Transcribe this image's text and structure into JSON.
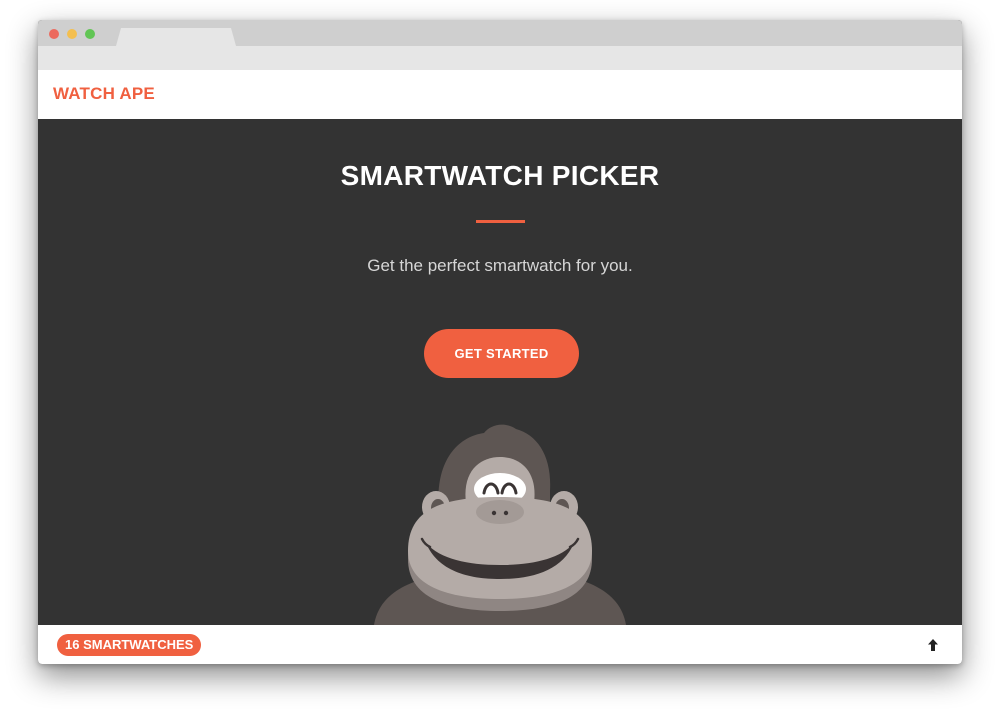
{
  "brand": {
    "name": "WATCH APE",
    "accent_color": "#f06040",
    "hero_background": "#333333"
  },
  "hero": {
    "title": "SMARTWATCH PICKER",
    "subtitle": "Get the perfect smartwatch for you.",
    "cta_label": "GET STARTED",
    "mascot": "gorilla-mascot"
  },
  "footer": {
    "count_badge": "16 SMARTWATCHES",
    "scroll_icon": "arrow-up-icon"
  },
  "window": {
    "controls": [
      "close",
      "minimize",
      "maximize"
    ]
  }
}
